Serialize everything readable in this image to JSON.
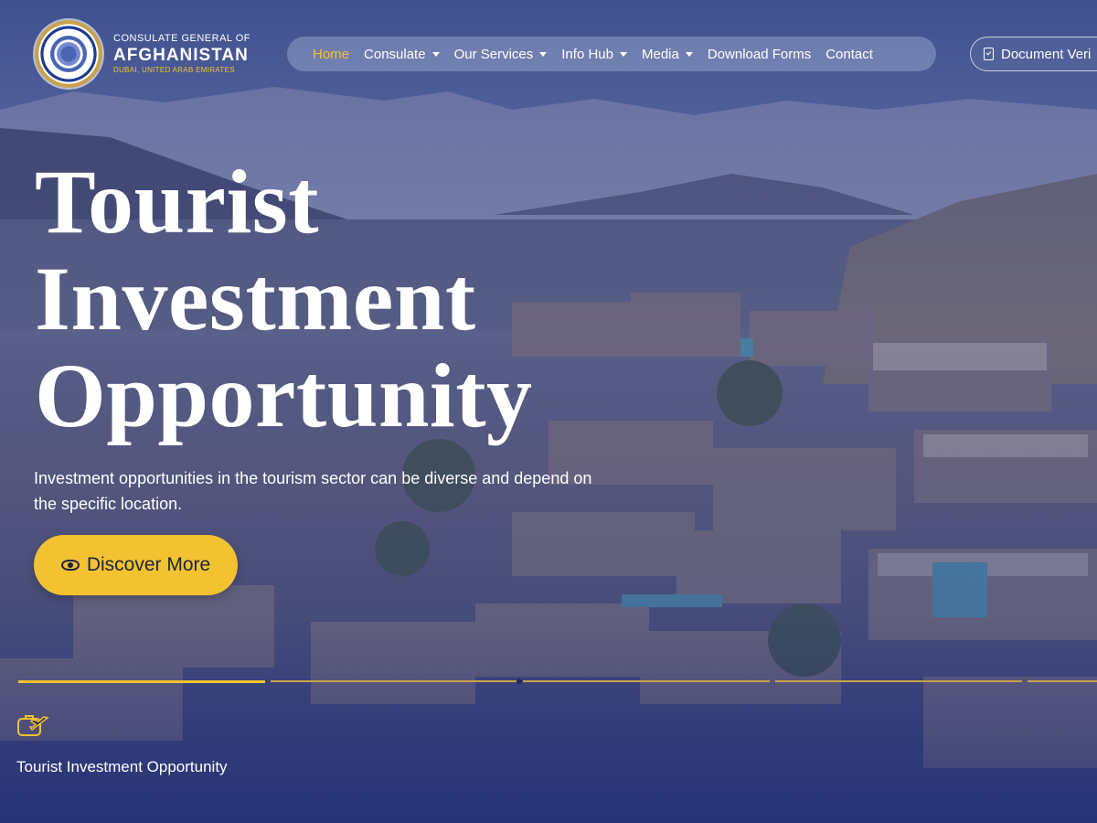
{
  "brand": {
    "top": "CONSULATE GENERAL OF",
    "main": "AFGHANISTAN",
    "sub": "DUBAI, UNITED ARAB EMIRATES"
  },
  "nav": {
    "items": [
      {
        "label": "Home",
        "active": true,
        "dropdown": false
      },
      {
        "label": "Consulate",
        "active": false,
        "dropdown": true
      },
      {
        "label": "Our Services",
        "active": false,
        "dropdown": true
      },
      {
        "label": "Info Hub",
        "active": false,
        "dropdown": true
      },
      {
        "label": "Media",
        "active": false,
        "dropdown": true
      },
      {
        "label": "Download Forms",
        "active": false,
        "dropdown": false
      },
      {
        "label": "Contact",
        "active": false,
        "dropdown": false
      }
    ],
    "doc_button": "Document Veri"
  },
  "hero": {
    "title_lines": [
      "Tourist",
      "Investment",
      "Opportunity"
    ],
    "description": "Investment opportunities in the tourism sector can be diverse and depend on the specific location.",
    "cta_label": "Discover More",
    "cta_icon": "eye-icon"
  },
  "slides": {
    "active_index": 0,
    "items": [
      {
        "label": "Tourist Investment Opportunity",
        "icon": "suitcase-plane-icon"
      }
    ]
  },
  "colors": {
    "accent": "#f2c230",
    "overlay": "#2a3a82",
    "text": "#ffffff"
  }
}
